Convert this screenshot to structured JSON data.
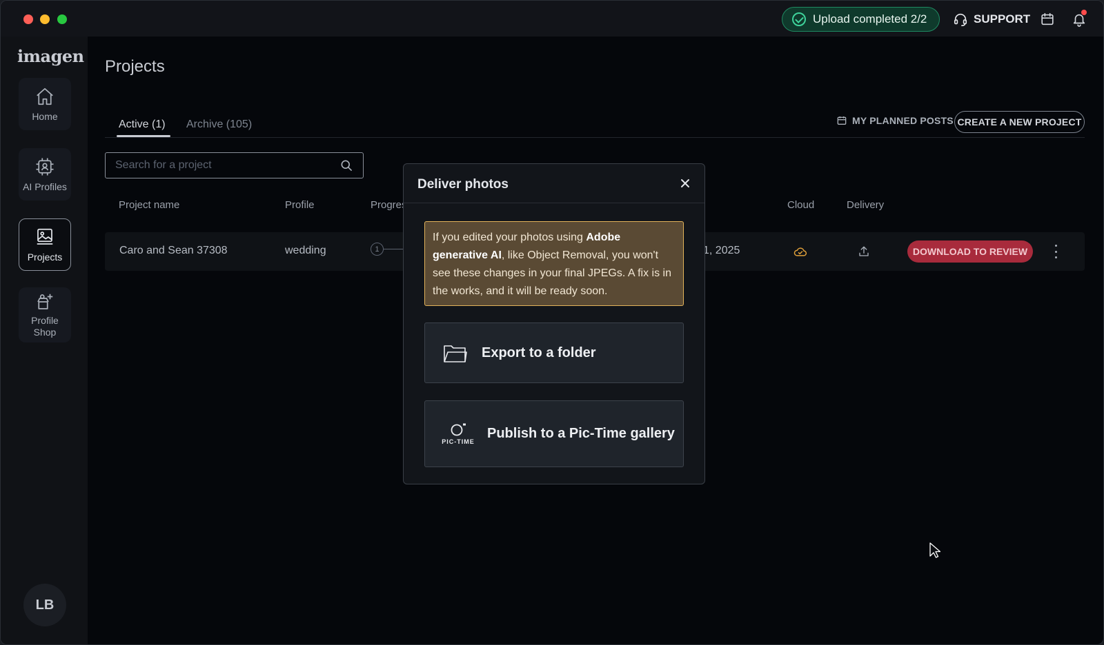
{
  "topbar": {
    "upload_status": "Upload completed 2/2",
    "support_label": "SUPPORT",
    "icons": [
      "headset-icon",
      "calendar-icon",
      "bell-icon"
    ],
    "notification_dot_color": "#ff4b4b"
  },
  "sidebar": {
    "logo": "imagen",
    "items": [
      {
        "label": "Home",
        "icon": "home-icon",
        "active": false
      },
      {
        "label": "AI Profiles",
        "icon": "ai-profile-icon",
        "active": false
      },
      {
        "label": "Projects",
        "icon": "image-icon",
        "active": true
      },
      {
        "label": "Profile\nShop",
        "icon": "shop-icon",
        "active": false
      }
    ],
    "avatar_initials": "LB"
  },
  "main": {
    "title": "Projects",
    "tabs": [
      {
        "label": "Active (1)",
        "active": true
      },
      {
        "label": "Archive (105)",
        "active": false
      }
    ],
    "planned_posts_label": "MY PLANNED POSTS",
    "create_project_label": "CREATE A NEW PROJECT",
    "search": {
      "placeholder": "Search for a project",
      "value": ""
    },
    "table": {
      "columns": [
        "Project name",
        "Profile",
        "Progres",
        "Cloud",
        "Delivery"
      ],
      "rows": [
        {
          "name": "Caro and Sean 37308",
          "profile": "wedding",
          "progress_step": "1",
          "date_partial": "1, 2025",
          "action_label": "DOWNLOAD TO REVIEW"
        }
      ]
    }
  },
  "modal": {
    "title": "Deliver photos",
    "notice": {
      "part1": "If you edited your photos using ",
      "bold": "Adobe generative AI",
      "part2": ", like Object Removal, you won't see these changes in your final JPEGs. A fix is in the works, and it will be ready soon."
    },
    "options": [
      {
        "label": "Export to a folder",
        "icon": "folder-icon"
      },
      {
        "label": "Publish to a Pic-Time gallery",
        "icon": "pic-time-logo",
        "logo_text": "PIC-TIME"
      }
    ]
  },
  "colors": {
    "accent_red": "#a82b3c",
    "success_green": "#3fd39b",
    "notice_border": "#e3b35a",
    "cloud_icon": "#e0a03a"
  }
}
